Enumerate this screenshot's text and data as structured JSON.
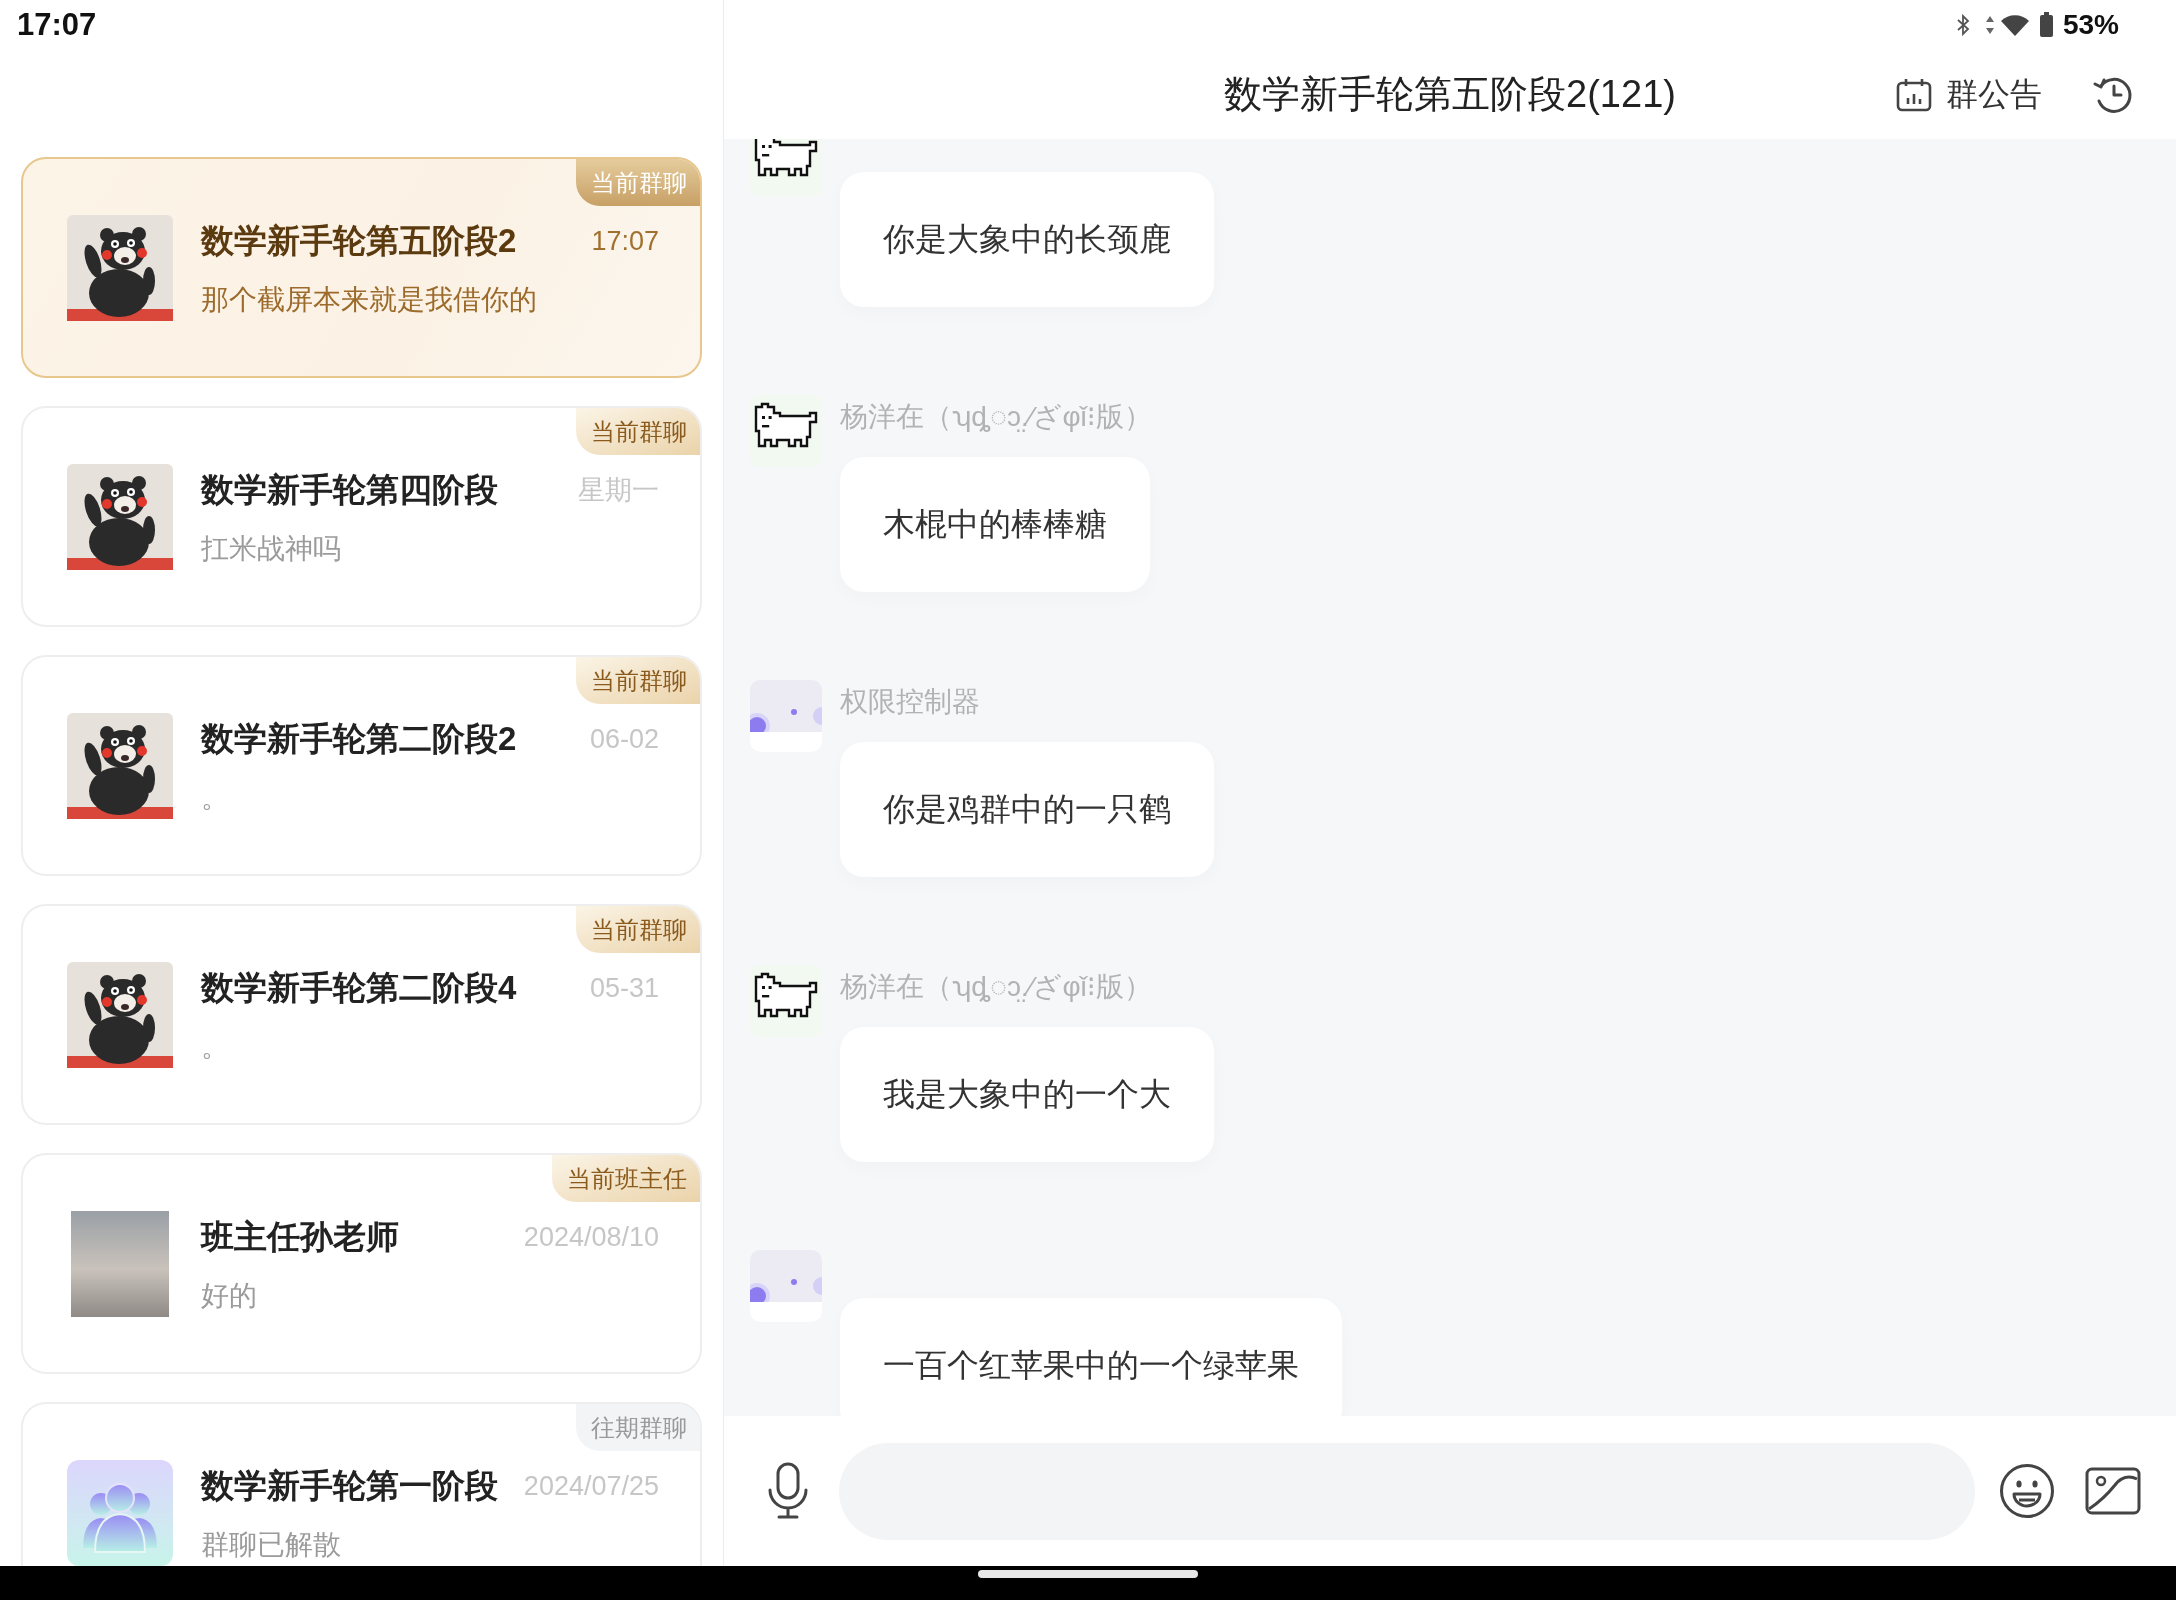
{
  "status_bar": {
    "time": "17:07",
    "battery": "53%"
  },
  "conversations": [
    {
      "title": "数学新手轮第五阶段2",
      "preview": "那个截屏本来就是我借你的",
      "time": "17:07",
      "badge": {
        "label": "当前群聊",
        "kind": "current"
      },
      "avatar": {
        "kind": "bear"
      },
      "selected": true
    },
    {
      "title": "数学新手轮第四阶段",
      "preview": "扛米战神吗",
      "time": "星期一",
      "badge": {
        "label": "当前群聊",
        "kind": "current"
      },
      "avatar": {
        "kind": "bear"
      },
      "selected": false
    },
    {
      "title": "数学新手轮第二阶段2",
      "preview": "。",
      "time": "06-02",
      "badge": {
        "label": "当前群聊",
        "kind": "current"
      },
      "avatar": {
        "kind": "bear"
      },
      "selected": false
    },
    {
      "title": "数学新手轮第二阶段4",
      "preview": "。",
      "time": "05-31",
      "badge": {
        "label": "当前群聊",
        "kind": "current"
      },
      "avatar": {
        "kind": "bear"
      },
      "selected": false
    },
    {
      "title": "班主任孙老师",
      "preview": "好的",
      "time": "2024/08/10",
      "badge": {
        "label": "当前班主任",
        "kind": "current"
      },
      "avatar": {
        "kind": "photo"
      },
      "selected": false
    },
    {
      "title": "数学新手轮第一阶段",
      "preview": "群聊已解散",
      "time": "2024/07/25",
      "badge": {
        "label": "往期群聊",
        "kind": "past"
      },
      "avatar": {
        "kind": "group"
      },
      "selected": false
    }
  ],
  "chat": {
    "title": "数学新手轮第五阶段2(121)",
    "notice_button": "群公告",
    "messages": [
      {
        "avatar": {
          "kind": "dog"
        },
        "text": "你是大象中的长颈鹿"
      },
      {
        "avatar": {
          "kind": "dog"
        },
        "sender": "杨洋在（ʮȡ◌ͻ̤.⁄ざφǐ⁝版）",
        "text": "木棍中的棒棒糖"
      },
      {
        "avatar": {
          "kind": "circles"
        },
        "sender": "权限控制器",
        "text": "你是鸡群中的一只鹤"
      },
      {
        "avatar": {
          "kind": "dog"
        },
        "sender": "杨洋在（ʮȡ◌ͻ̤.⁄ざφǐ⁝版）",
        "text": "我是大象中的一个大"
      },
      {
        "avatar": {
          "kind": "circles"
        },
        "text": "一百个红苹果中的一个绿苹果"
      }
    ]
  }
}
